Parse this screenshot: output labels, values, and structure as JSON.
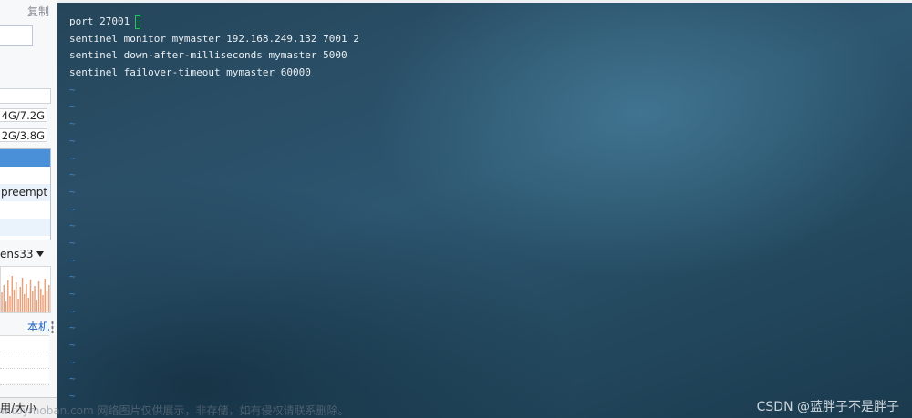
{
  "sidebar": {
    "copy_label": "复制",
    "memory": "4G/7.2G",
    "swap": "2G/3.8G",
    "process_item": "preempt",
    "interface": "ens33",
    "local_label": "本机",
    "column_header": "用/大小"
  },
  "terminal": {
    "lines": [
      "port 27001",
      "sentinel monitor mymaster 192.168.249.132 7001 2",
      "sentinel down-after-milliseconds mymaster 5000",
      "sentinel failover-timeout mymaster 60000"
    ],
    "tilde": "~",
    "cursor_color": "#27c45a",
    "text_color": "#e8eef2",
    "tilde_color": "#3f86c7"
  },
  "watermarks": {
    "left": "w.toymoban.com 网络图片仅供展示，非存储，如有侵权请联系删除。",
    "right": "CSDN @蓝胖子不是胖子"
  },
  "colors": {
    "selection": "#4a90d9",
    "link": "#1e5fbf",
    "chart_bar": "#e8a07a"
  }
}
